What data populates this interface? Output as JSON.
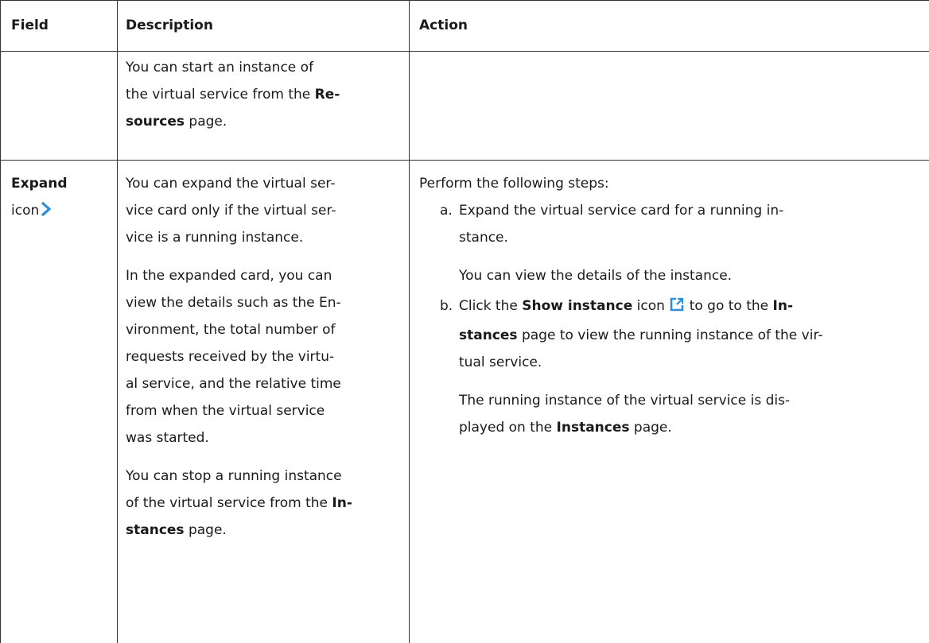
{
  "table": {
    "headers": [
      "Field",
      "Description",
      "Action"
    ],
    "row1": {
      "desc": {
        "line1": "You can start an instance of",
        "line2": "the virtual service from the ",
        "line2_bold": "Re-",
        "line3_bold": "sources",
        "line3": " page."
      }
    },
    "row2": {
      "field_bold": "Expand",
      "field_rest": "icon",
      "desc_p1": [
        "You can expand the virtual ser-",
        "vice card only if the virtual ser-",
        "vice is a running instance."
      ],
      "desc_p2": [
        "In the expanded card, you can",
        "view the details such as the En-",
        "vironment, the total number of",
        "requests received by the virtu-",
        "al service, and the relative time",
        "from when the virtual service",
        "was started."
      ],
      "desc_p3": {
        "line1": "You can stop a running instance",
        "line2": "of the virtual service from the ",
        "line2_bold": "In-",
        "line3_bold": "stances",
        "line3": " page."
      },
      "action_intro": "Perform the following steps:",
      "step_a": {
        "marker": "a.",
        "line1": "Expand the virtual service card for a running in-",
        "line2": "stance.",
        "note": "You can view the details of the instance."
      },
      "step_b": {
        "marker": "b.",
        "pre": "Click the ",
        "bold1": "Show instance",
        "mid": " icon ",
        "post": " to go to the ",
        "bold2": "In-",
        "line2_bold": "stances",
        "line2": " page to view the running instance of the vir-",
        "line3": "tual service.",
        "note1": "The running instance of the virtual service is dis-",
        "note2_pre": "played on the ",
        "note2_bold": "Instances",
        "note2_post": " page."
      }
    }
  },
  "colors": {
    "icon_blue": "#2d8fd8",
    "rule": "#333333"
  },
  "icons": {
    "expand": "chevron-right-icon",
    "show_instance": "external-link-icon"
  }
}
